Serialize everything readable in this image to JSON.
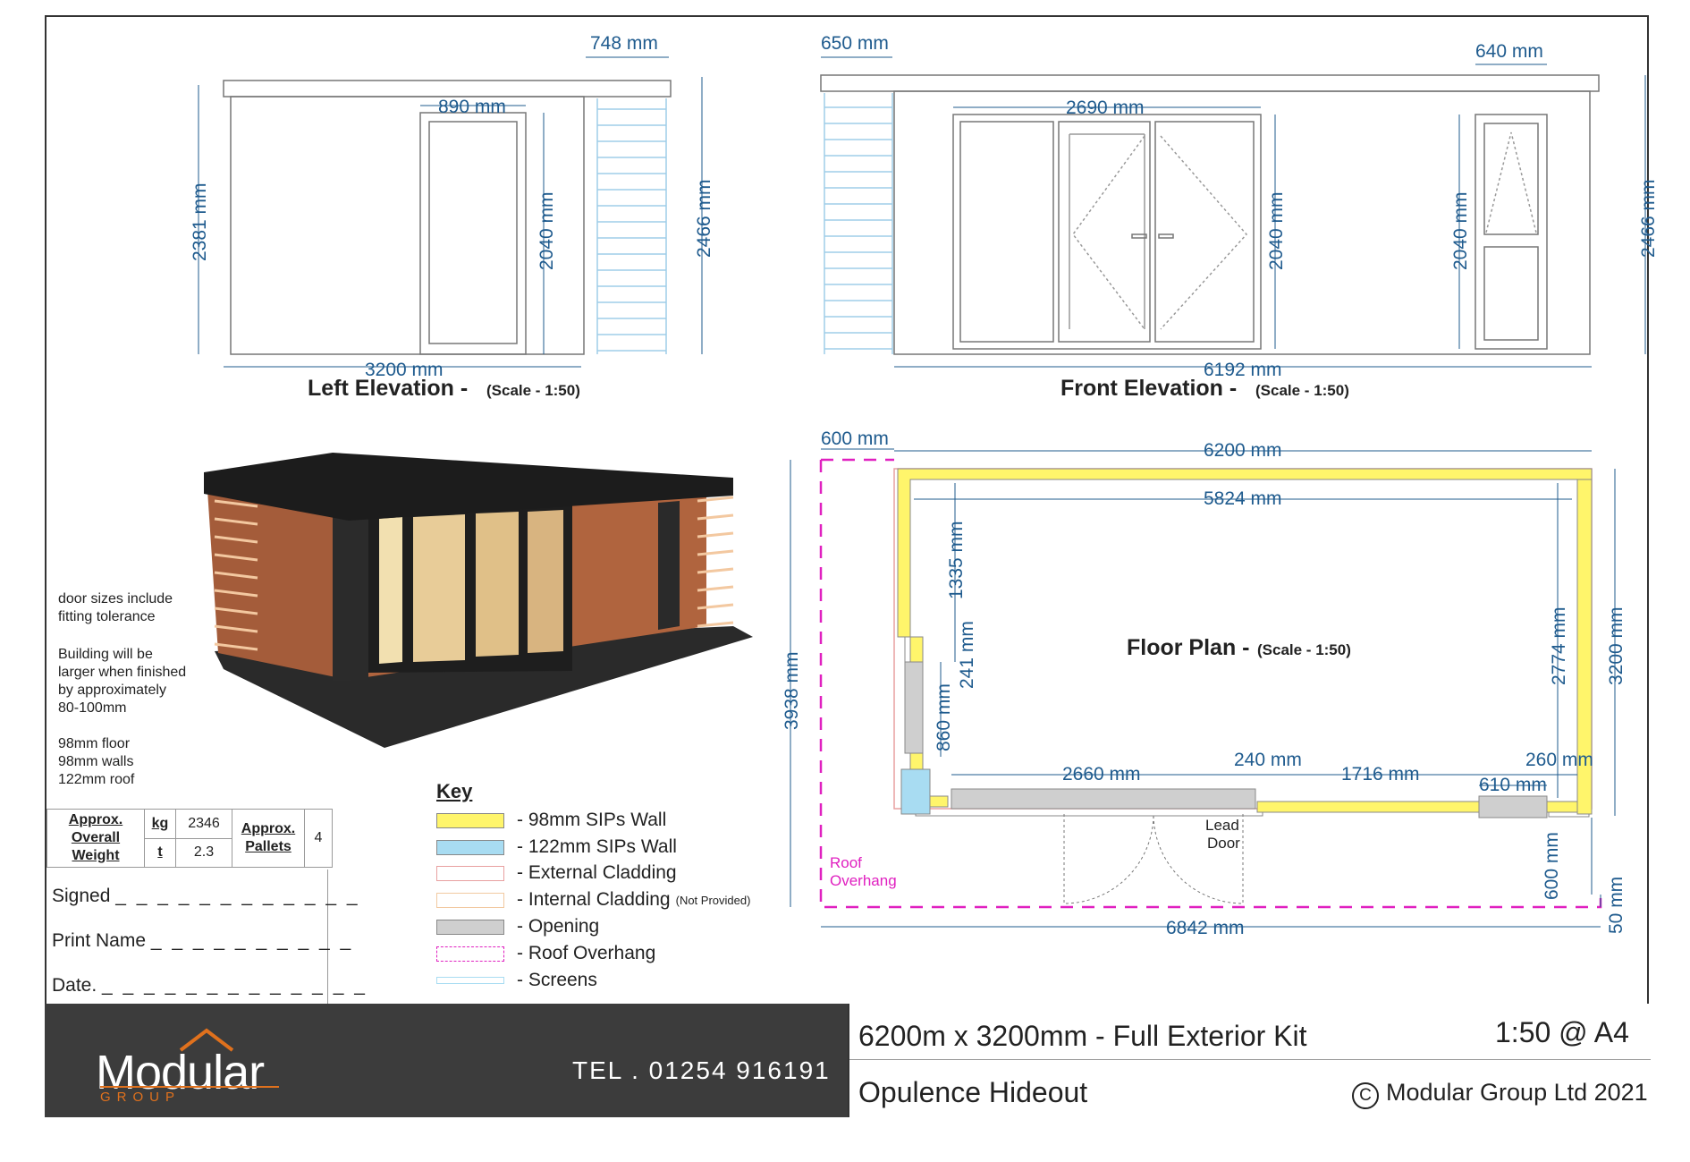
{
  "drawing": {
    "left_elevation": {
      "title": "Left Elevation -",
      "scale": "(Scale - 1:50)",
      "dims": {
        "overhang": "748 mm",
        "door_width": "890 mm",
        "total_height": "2381 mm",
        "door_height": "2040 mm",
        "roof_height": "2466 mm",
        "width": "3200 mm"
      }
    },
    "front_elevation": {
      "title": "Front Elevation -",
      "scale": "(Scale - 1:50)",
      "dims": {
        "overhang": "650 mm",
        "window_width": "640 mm",
        "door_width": "2690 mm",
        "door_height": "2040 mm",
        "window_height": "2040 mm",
        "roof_height": "2466 mm",
        "width": "6192 mm"
      }
    },
    "floor_plan": {
      "title": "Floor Plan -",
      "scale": "(Scale - 1:50)",
      "dims": {
        "overhang_top": "600 mm",
        "outer_width": "6200 mm",
        "inner_width": "5824 mm",
        "d1335": "1335 mm",
        "d241": "241 mm",
        "d860": "860 mm",
        "overall_depth": "3938 mm",
        "inner_depth": "2774 mm",
        "outer_depth": "3200 mm",
        "d2660": "2660 mm",
        "d240": "240 mm",
        "d1716": "1716 mm",
        "d260": "260 mm",
        "d610": "610 mm",
        "d600_side": "600 mm",
        "d50": "50 mm",
        "overall_width": "6842 mm"
      },
      "labels": {
        "lead_door_1": "Lead",
        "lead_door_2": "Door",
        "roof_overhang_1": "Roof",
        "roof_overhang_2": "Overhang"
      }
    }
  },
  "notes": {
    "door_sizes": [
      "door sizes include",
      "fitting tolerance"
    ],
    "building": [
      "Building will be",
      "larger when finished",
      "by approximately",
      "80-100mm"
    ],
    "specs": [
      "98mm floor",
      "98mm walls",
      "122mm roof"
    ]
  },
  "weight_table": {
    "label": [
      "Approx.",
      "Overall",
      "Weight"
    ],
    "unit_kg": "kg",
    "value_kg": "2346",
    "unit_t": "t",
    "value_t": "2.3",
    "pallets_label": [
      "Approx.",
      "Pallets"
    ],
    "pallets": "4"
  },
  "sign_off": {
    "signed": "Signed",
    "print_name": "Print Name",
    "date": "Date."
  },
  "key": {
    "title": "Key",
    "items": [
      {
        "label": "- 98mm SIPs Wall",
        "color": "#fff56b"
      },
      {
        "label": "- 122mm SIPs Wall",
        "color": "#a8dcf2"
      },
      {
        "label": "- External Cladding",
        "color": "#e8a0a0"
      },
      {
        "label": "- Internal Cladding",
        "note": "(Not Provided)",
        "color": "#f2c9a0"
      },
      {
        "label": "- Opening",
        "color": "#cfcfcf"
      },
      {
        "label": "- Roof Overhang",
        "color": "#e020c0"
      },
      {
        "label": "- Screens",
        "color": "#a8dcf2"
      }
    ]
  },
  "footer": {
    "logo": "Modular",
    "logo_sub": "GROUP",
    "tel": "TEL . 01254 916191",
    "product": "6200m x 3200mm - Full Exterior Kit",
    "scale": "1:50 @ A4",
    "name": "Opulence Hideout",
    "copyright": "Modular Group Ltd 2021",
    "copyright_symbol": "C"
  },
  "colors": {
    "dimension": "#1f5b8e",
    "wall_98": "#fff56b",
    "wall_122": "#a8dcf2",
    "overhang": "#e020c0",
    "footer_dark": "#3c3c3c",
    "logo_accent": "#e0711d"
  }
}
